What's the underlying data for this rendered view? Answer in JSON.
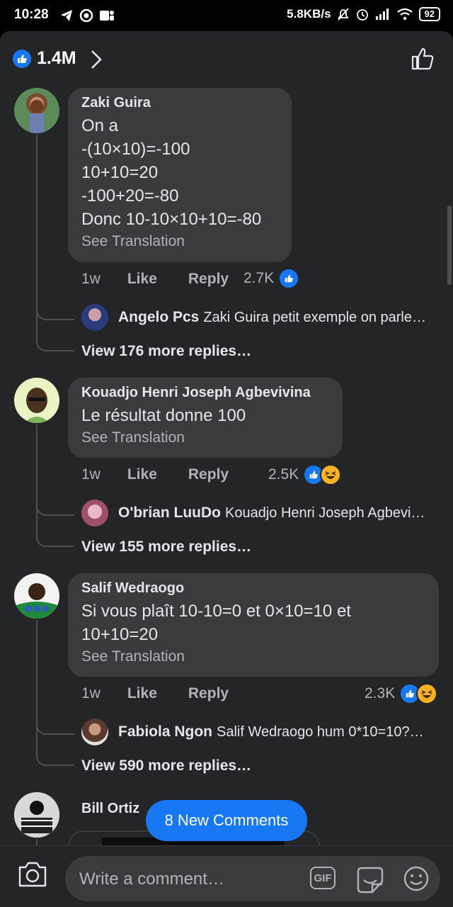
{
  "status_bar": {
    "time": "10:28",
    "net_speed": "5.8KB/s",
    "battery": "92"
  },
  "header": {
    "reaction_count": "1.4M"
  },
  "comments": [
    {
      "author": "Zaki Guira",
      "lines": [
        "On a",
        "-(10×10)=-100",
        "10+10=20",
        "-100+20=-80",
        "Donc 10-10×10+10=-80"
      ],
      "see_translation": "See Translation",
      "time": "1w",
      "like": "Like",
      "reply": "Reply",
      "reaction_count": "2.7K",
      "reply_preview": {
        "name": "Angelo Pcs",
        "text": "Zaki Guira petit exemple on parle…"
      },
      "view_more": "View 176 more replies…"
    },
    {
      "author": "Kouadjo Henri Joseph Agbevivina",
      "lines": [
        "Le résultat donne 100"
      ],
      "see_translation": "See Translation",
      "time": "1w",
      "like": "Like",
      "reply": "Reply",
      "reaction_count": "2.5K",
      "reply_preview": {
        "name": "O'brian LuuDo",
        "text": "Kouadjo Henri Joseph Agbevi…"
      },
      "view_more": "View 155 more replies…"
    },
    {
      "author": "Salif Wedraogo",
      "lines": [
        "Si vous plaît 10-10=0 et 0×10=10 et",
        "10+10=20"
      ],
      "see_translation": "See Translation",
      "time": "1w",
      "like": "Like",
      "reply": "Reply",
      "reaction_count": "2.3K",
      "reply_preview": {
        "name": "Fabiola Ngon",
        "text": "Salif Wedraogo hum 0*10=10?…"
      },
      "view_more": "View 590 more replies…"
    },
    {
      "author": "Bill Ortiz"
    }
  ],
  "new_comments_pill": "8 New Comments",
  "composer": {
    "placeholder": "Write a comment…",
    "gif_label": "GIF"
  },
  "colors": {
    "accent": "#1877f2",
    "bubble": "#3a3b3c",
    "background": "#242526",
    "haha": "#f7b125"
  }
}
